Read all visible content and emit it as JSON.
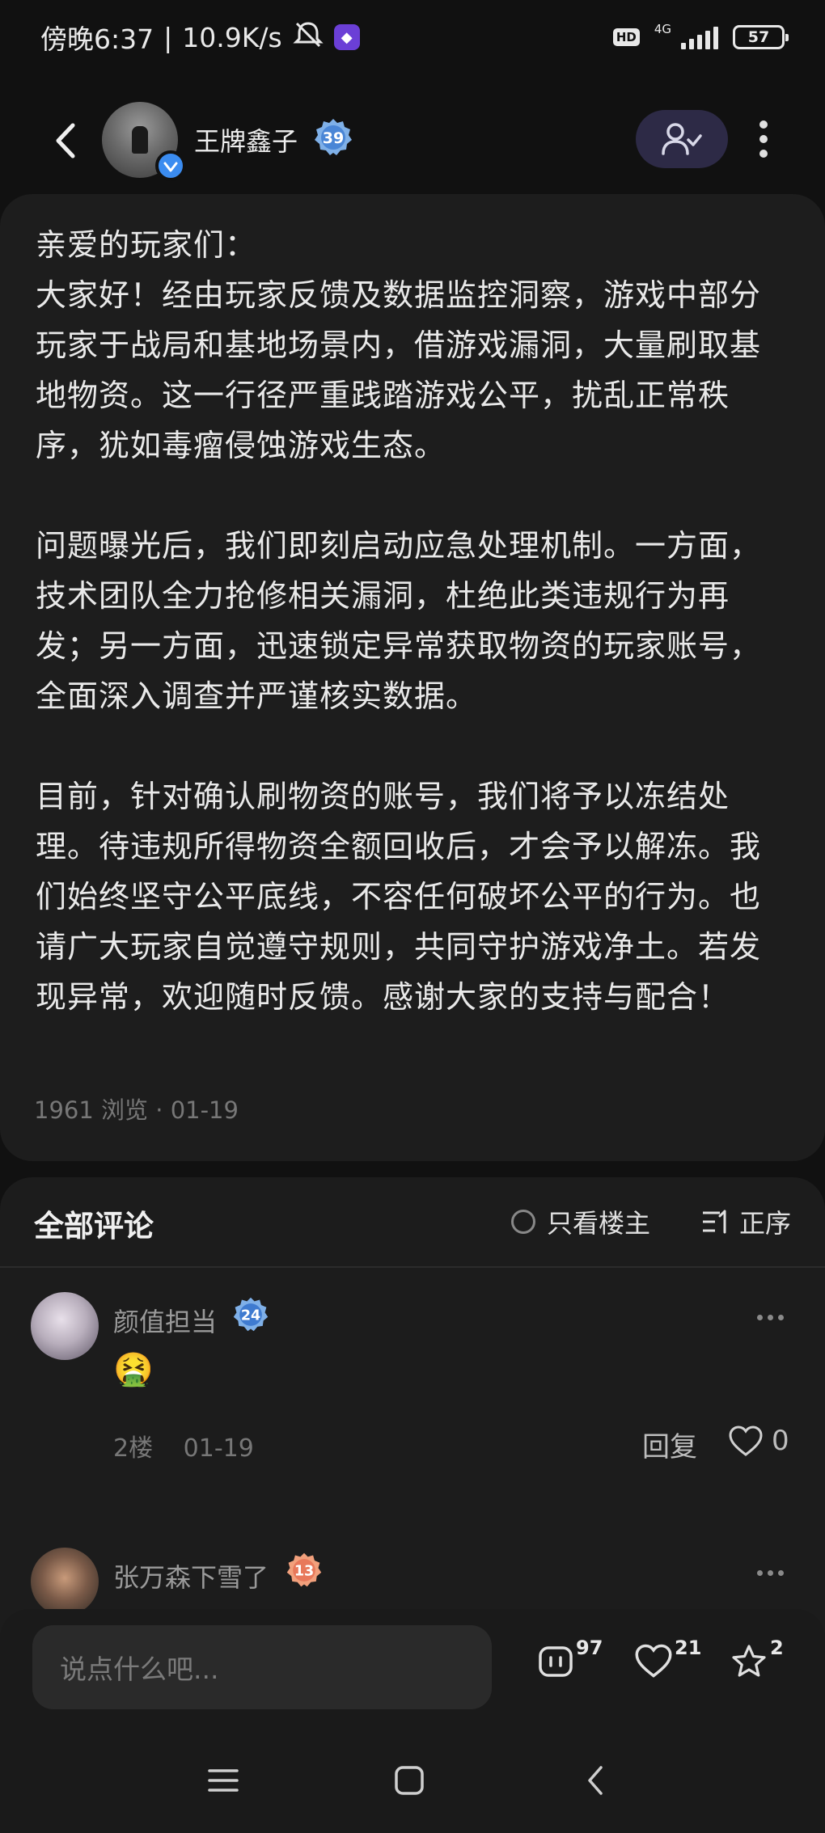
{
  "status_bar": {
    "time": "傍晚6:37",
    "speed": "10.9K/s",
    "hd": "HD",
    "network": "4G",
    "battery": "57",
    "icons": [
      "mute-bell-icon",
      "app-icon",
      "signal-icon",
      "battery-icon"
    ]
  },
  "header": {
    "username": "王牌鑫子",
    "level": "39",
    "icons": [
      "back-arrow-icon",
      "verified-icon",
      "follow-user-icon",
      "more-vertical-icon"
    ]
  },
  "post": {
    "greeting": "亲爱的玩家们：",
    "paragraphs": [
      "大家好！经由玩家反馈及数据监控洞察，游戏中部分玩家于战局和基地场景内，借游戏漏洞，大量刷取基地物资。这一行径严重践踏游戏公平，扰乱正常秩序，犹如毒瘤侵蚀游戏生态。",
      "问题曝光后，我们即刻启动应急处理机制。一方面，技术团队全力抢修相关漏洞，杜绝此类违规行为再发；另一方面，迅速锁定异常获取物资的玩家账号，全面深入调查并严谨核实数据。",
      "目前，针对确认刷物资的账号，我们将予以冻结处理。待违规所得物资全额回收后，才会予以解冻。我们始终坚守公平底线，不容任何破坏公平的行为。也请广大玩家自觉遵守规则，共同守护游戏净土。若发现异常，欢迎随时反馈。感谢大家的支持与配合！"
    ],
    "views": "1961 浏览",
    "date": "01-19"
  },
  "comments": {
    "title": "全部评论",
    "only_host": "只看楼主",
    "sort": "正序",
    "items": [
      {
        "name": "颜值担当",
        "level": "24",
        "content": "🤮",
        "floor": "2楼",
        "date": "01-19",
        "reply": "回复",
        "likes": "0"
      },
      {
        "name": "张万森下雪了",
        "level": "13"
      }
    ]
  },
  "bottom_bar": {
    "input_placeholder": "说点什么吧...",
    "comment_count": "97",
    "like_count": "21",
    "star_count": "2",
    "icons": [
      "comment-icon",
      "heart-icon",
      "star-icon"
    ]
  },
  "nav": {
    "icons": [
      "menu-icon",
      "home-icon",
      "back-icon"
    ]
  },
  "colors": {
    "accent": "#3b8cf0",
    "follow_bg": "#2d2a46",
    "card_bg": "#1d1d1d",
    "page_bg": "#111111"
  }
}
